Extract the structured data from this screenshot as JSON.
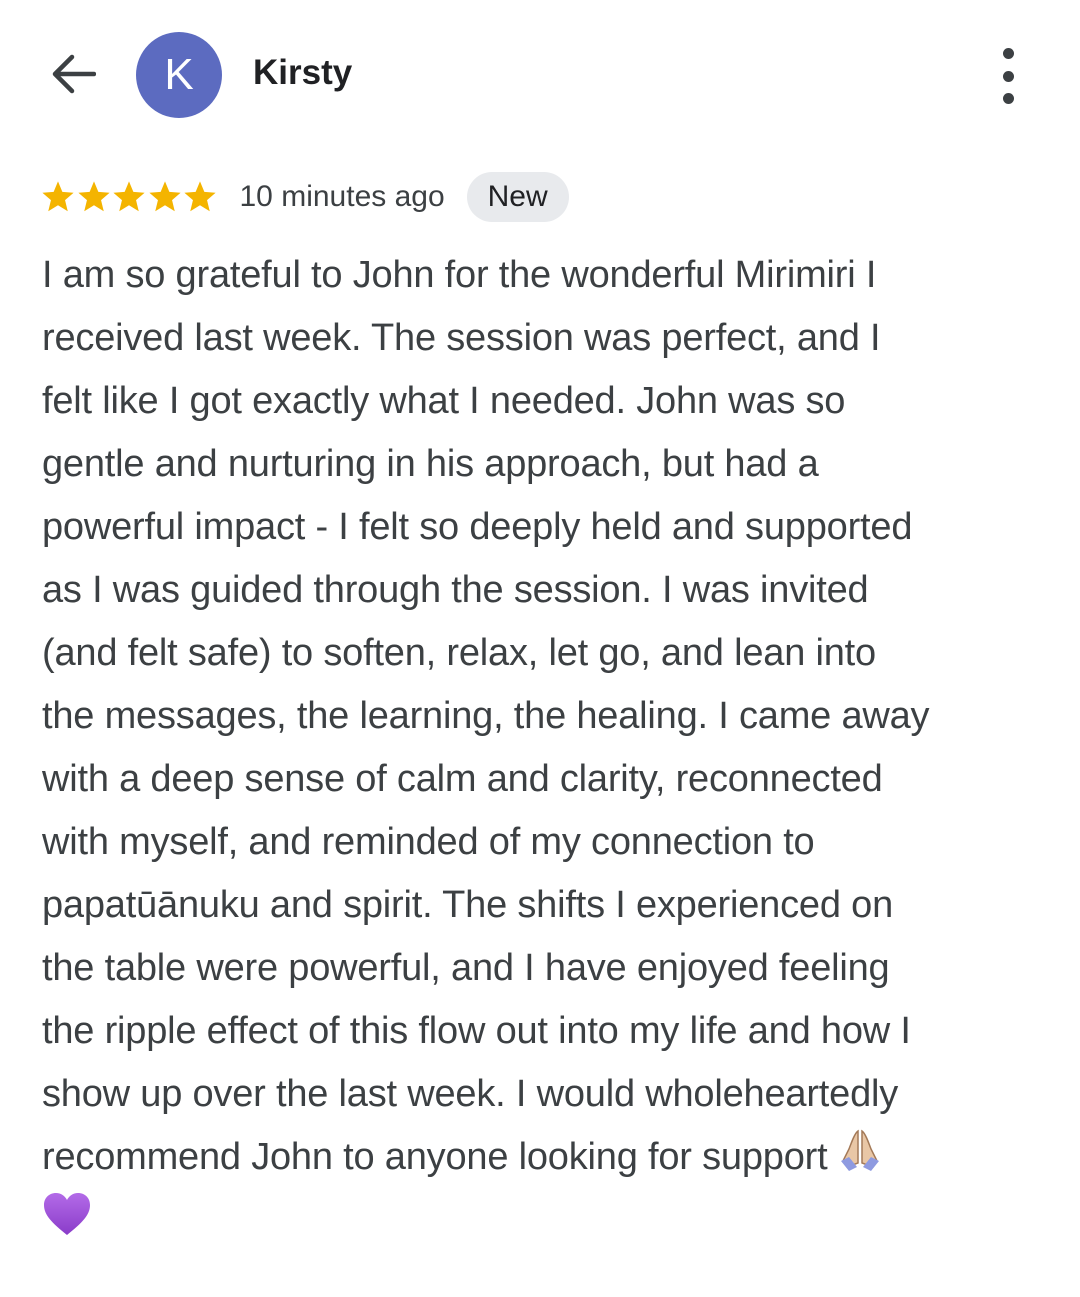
{
  "header": {
    "back_icon": "arrow-left-icon",
    "avatar_initial": "K",
    "user_name": "Kirsty",
    "more_icon": "more-vertical-icon"
  },
  "review": {
    "rating": 5,
    "rating_max": 5,
    "time_ago": "10 minutes ago",
    "badge": "New",
    "lines": [
      "I am so grateful to John for the wonderful Mirimiri I",
      "received last week. The session was perfect, and I",
      "felt like I got exactly what I needed. John was so",
      "gentle and nurturing in his approach, but had a",
      "powerful impact - I felt so deeply held and supported",
      "as I was guided through the session. I was invited",
      "(and felt safe) to soften, relax, let go, and lean into",
      "the messages, the learning, the healing. I came away",
      "with a deep sense of calm and clarity, reconnected",
      "with myself, and reminded of my connection to",
      "papatūānuku and spirit. The shifts I experienced on",
      "the table were powerful, and I have enjoyed feeling",
      "the ripple effect of this flow out into my life and how I",
      "show up over the last week. I would wholeheartedly",
      "recommend John to anyone looking for support"
    ],
    "emojis": [
      "folded-hands-emoji",
      "purple-heart-emoji"
    ]
  },
  "colors": {
    "avatar_bg": "#5c6bc0",
    "star": "#f4b400",
    "badge_bg": "#e8eaed",
    "badge_text": "#202124",
    "text": "#3c4043"
  }
}
